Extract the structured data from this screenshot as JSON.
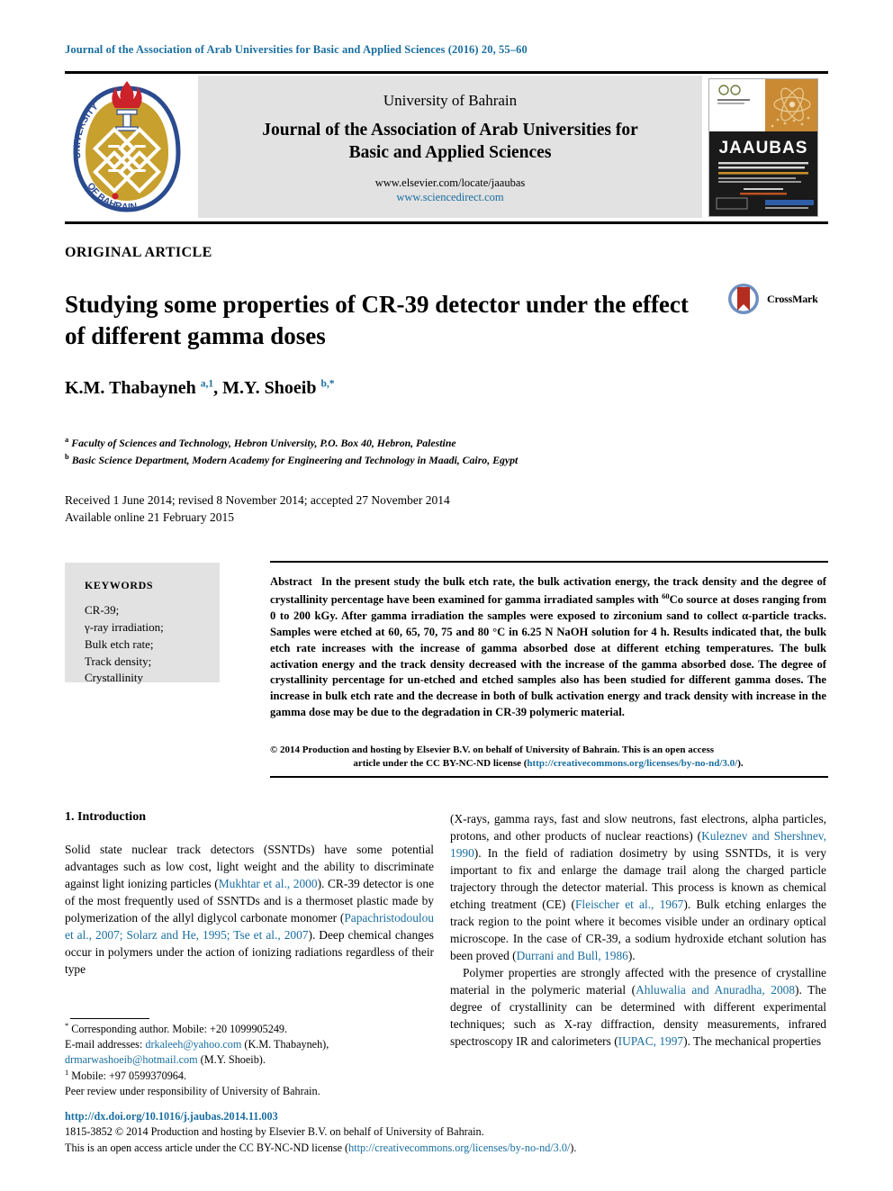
{
  "running_head": "Journal of the Association of Arab Universities for Basic and Applied Sciences (2016) 20, 55–60",
  "banner": {
    "logo_alt": "university-of-bahrain-logo",
    "university": "University of Bahrain",
    "journal_title_line1": "Journal of the Association of Arab Universities for",
    "journal_title_line2": "Basic and Applied Sciences",
    "url_elsevier": "www.elsevier.com/locate/jaaubas",
    "url_sciencedirect": "www.sciencedirect.com",
    "cover_title": "JAAUBAS",
    "cover_alt": "journal-cover-thumbnail"
  },
  "article": {
    "type": "ORIGINAL ARTICLE",
    "title": "Studying some properties of CR-39 detector under the effect of different gamma doses",
    "crossmark_label": "CrossMark",
    "authors_html": "K.M. Thabayneh <sup>a,1</sup>, M.Y. Shoeib <sup>b,</sup><sup>*</sup>",
    "affiliation_a": "Faculty of Sciences and Technology, Hebron University, P.O. Box 40, Hebron, Palestine",
    "affiliation_b": "Basic Science Department, Modern Academy for Engineering and Technology in Maadi, Cairo, Egypt",
    "dates_line1": "Received 1 June 2014; revised 8 November 2014; accepted 27 November 2014",
    "dates_line2": "Available online 21 February 2015"
  },
  "keywords": {
    "heading": "KEYWORDS",
    "items": [
      "CR-39;",
      "γ-ray irradiation;",
      "Bulk etch rate;",
      "Track density;",
      "Crystallinity"
    ]
  },
  "abstract": {
    "label": "Abstract",
    "text_html": "In the present study the bulk etch rate, the bulk activation energy, the track density and the degree of crystallinity percentage have been examined for gamma irradiated samples with <sup>60</sup>Co source at doses ranging from 0 to 200 kGy. After gamma irradiation the samples were exposed to zirconium sand to collect α-particle tracks. Samples were etched at 60, 65, 70, 75 and 80 °C in 6.25 N NaOH solution for 4 h. Results indicated that, the bulk etch rate increases with the increase of gamma absorbed dose at different etching temperatures. The bulk activation energy and the track density decreased with the increase of the gamma absorbed dose. The degree of crystallinity percentage for un-etched and etched samples also has been studied for different gamma doses. The increase in bulk etch rate and the decrease in both of bulk activation energy and track density with increase in the gamma dose may be due to the degradation in CR-39 polymeric material.",
    "copyright_line1": "© 2014 Production and hosting by Elsevier B.V. on behalf of University of Bahrain. This is an open access",
    "copyright_line2_pre": "article under the CC BY-NC-ND license (",
    "copyright_link": "http://creativecommons.org/licenses/by-no-nd/3.0/",
    "copyright_line2_post": ")."
  },
  "body": {
    "section_heading": "1. Introduction",
    "left_paragraph_html": "Solid state nuclear track detectors (SSNTDs) have some potential advantages such as low cost, light weight and the ability to discriminate against light ionizing particles (<span class=\"cite\">Mukhtar et al., 2000</span>). CR-39 detector is one of the most frequently used of SSNTDs and is a thermoset plastic made by polymerization of the allyl diglycol carbonate monomer (<span class=\"cite\">Papachristodoulou et al., 2007; Solarz and He, 1995; Tse et al., 2007</span>). Deep chemical changes occur in polymers under the action of ionizing radiations regardless of their type",
    "right_paragraph1_html": "(X-rays, gamma rays, fast and slow neutrons, fast electrons, alpha particles, protons, and other products of nuclear reactions) (<span class=\"cite\">Kuleznev and Shershnev, 1990</span>). In the field of radiation dosimetry by using SSNTDs, it is very important to fix and enlarge the damage trail along the charged particle trajectory through the detector material. This process is known as chemical etching treatment (CE) (<span class=\"cite\">Fleischer et al., 1967</span>). Bulk etching enlarges the track region to the point where it becomes visible under an ordinary optical microscope. In the case of CR-39, a sodium hydroxide etchant solution has been proved (<span class=\"cite\">Durrani and Bull, 1986</span>).",
    "right_paragraph2_html": "Polymer properties are strongly affected with the presence of crystalline material in the polymeric material (<span class=\"cite\">Ahluwalia and Anuradha, 2008</span>). The degree of crystallinity can be determined with different experimental techniques; such as X-ray diffraction, density measurements, infrared spectroscopy IR and calorimeters (<span class=\"cite\">IUPAC, 1997</span>). The mechanical properties"
  },
  "footnotes": {
    "corresponding_html": "<sup>*</sup> Corresponding author. Mobile: +20 1099905249.",
    "email_html": "E-mail addresses: <span class=\"lnk\">drkaleeh@yahoo.com</span> (K.M. Thabayneh), <span class=\"lnk\">drmarwashoeib@hotmail.com</span> (M.Y. Shoeib).",
    "mobile_html": "<sup>1</sup> Mobile: +97 0599370964.",
    "peer_review": "Peer review under responsibility of University of Bahrain.",
    "doi": "http://dx.doi.org/10.1016/j.jaubas.2014.11.003",
    "issn_line": "1815-3852 © 2014 Production and hosting by Elsevier B.V. on behalf of University of Bahrain.",
    "license_pre": "This is an open access article under the CC BY-NC-ND license (",
    "license_link": "http://creativecommons.org/licenses/by-no-nd/3.0/",
    "license_post": ")."
  },
  "colors": {
    "link": "#1a6ea0",
    "panel_gray": "#e2e2e2",
    "logo_gold": "#c8a02e",
    "crossmark_red": "#b42d1e",
    "crossmark_blue": "#6d8fc0"
  }
}
